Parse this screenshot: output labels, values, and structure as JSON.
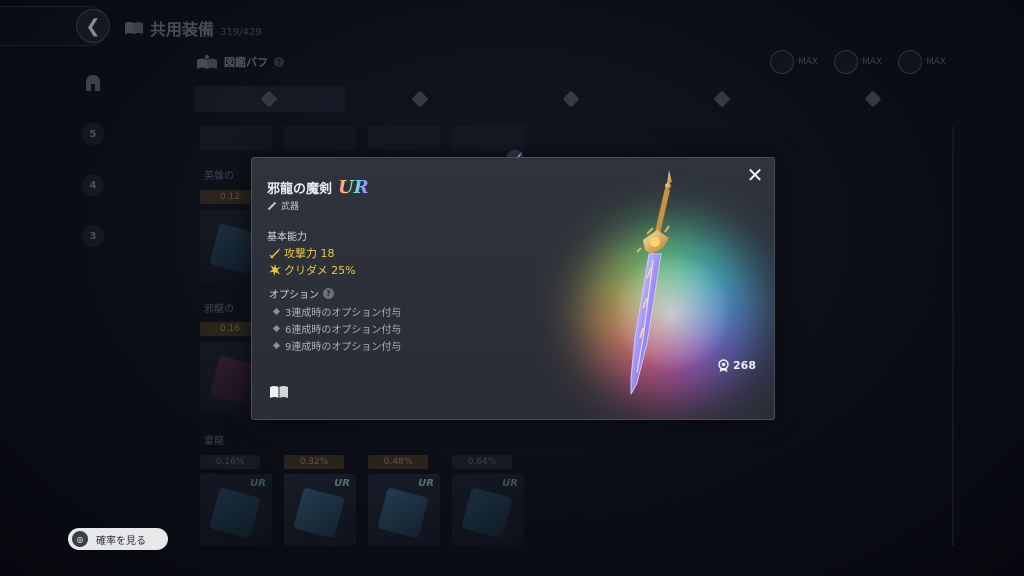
{
  "header": {
    "title": "共用装備",
    "count": "319/429"
  },
  "buff": {
    "label": "図鑑バフ",
    "max_labels": [
      "MAX",
      "MAX",
      "MAX"
    ]
  },
  "side_tabs": [
    "3",
    "4",
    "5"
  ],
  "list_sections": [
    {
      "label": "英雄の",
      "pill": "0.12"
    },
    {
      "label": "邪龍の",
      "pill": "0.16"
    },
    {
      "label": "雷龍",
      "pills": [
        "0.16%",
        "0.32%",
        "0.48%",
        "0.64%"
      ]
    }
  ],
  "card_badge": "UR",
  "probability_button": "確率を見る",
  "item": {
    "name": "邪龍の魔剣",
    "rarity": "UR",
    "type": "武器",
    "basic_title": "基本能力",
    "stats": [
      {
        "label": "攻撃力 18",
        "icon": "attack-icon"
      },
      {
        "label": "クリダメ 25%",
        "icon": "crit-damage-icon"
      }
    ],
    "options_title": "オプション",
    "options": [
      "3連成時のオプション付与",
      "6連成時のオプション付与",
      "9連成時のオプション付与"
    ],
    "score": "268"
  },
  "colors": {
    "accent_gold": "#f0c63e",
    "modal_bg": "#2e3139"
  }
}
